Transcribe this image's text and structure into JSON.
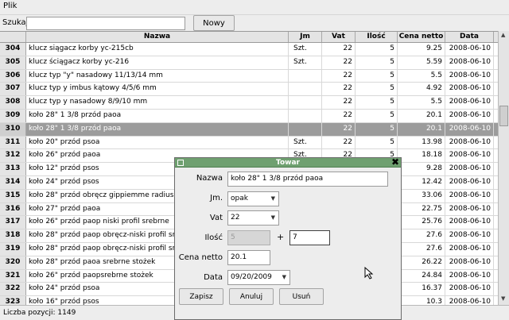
{
  "menubar": {
    "file_label": "Plik"
  },
  "search": {
    "label": "Szukaj",
    "value": "",
    "new_button": "Nowy"
  },
  "table": {
    "columns": [
      "",
      "Nazwa",
      "Jm",
      "Vat",
      "Ilość",
      "Cena netto",
      "Data"
    ],
    "rows": [
      {
        "id": "304",
        "name": "klucz siągacz korby yc-215cb",
        "jm": "Szt.",
        "vat": "22",
        "ilosc": "5",
        "cena": "9.25",
        "data": "2008-06-10"
      },
      {
        "id": "305",
        "name": "klucz ściągacz korby yc-216",
        "jm": "Szt.",
        "vat": "22",
        "ilosc": "5",
        "cena": "5.59",
        "data": "2008-06-10"
      },
      {
        "id": "306",
        "name": "klucz typ \"y\" nasadowy 11/13/14 mm",
        "jm": "",
        "vat": "22",
        "ilosc": "5",
        "cena": "5.5",
        "data": "2008-06-10"
      },
      {
        "id": "307",
        "name": "klucz typ y imbus kątowy  4/5/6 mm",
        "jm": "",
        "vat": "22",
        "ilosc": "5",
        "cena": "4.92",
        "data": "2008-06-10"
      },
      {
        "id": "308",
        "name": "klucz typ y nasadowy  8/9/10 mm",
        "jm": "",
        "vat": "22",
        "ilosc": "5",
        "cena": "5.5",
        "data": "2008-06-10"
      },
      {
        "id": "309",
        "name": "koło 28\" 1 3/8 przód  paoa",
        "jm": "",
        "vat": "22",
        "ilosc": "5",
        "cena": "20.1",
        "data": "2008-06-10"
      },
      {
        "id": "310",
        "name": "koło 28\" 1 3/8 przód paoa",
        "jm": "",
        "vat": "22",
        "ilosc": "5",
        "cena": "20.1",
        "data": "2008-06-10",
        "selected": true
      },
      {
        "id": "311",
        "name": "koło 20\"  przód psoa",
        "jm": "Szt.",
        "vat": "22",
        "ilosc": "5",
        "cena": "13.98",
        "data": "2008-06-10"
      },
      {
        "id": "312",
        "name": "koło 26\" przód  paoa",
        "jm": "Szt.",
        "vat": "22",
        "ilosc": "5",
        "cena": "18.18",
        "data": "2008-06-10"
      },
      {
        "id": "313",
        "name": "koło 12\" przód  psos",
        "jm": "",
        "vat": "",
        "ilosc": "",
        "cena": "9.28",
        "data": "2008-06-10"
      },
      {
        "id": "314",
        "name": "koło 24\" przód  psos",
        "jm": "",
        "vat": "",
        "ilosc": "",
        "cena": "12.42",
        "data": "2008-06-10"
      },
      {
        "id": "315",
        "name": "koło 28\" przód obręcz gippiemme radius",
        "jm": "",
        "vat": "",
        "ilosc": "",
        "cena": "33.06",
        "data": "2008-06-10"
      },
      {
        "id": "316",
        "name": "koło 27\" przód paoa",
        "jm": "",
        "vat": "",
        "ilosc": "",
        "cena": "22.75",
        "data": "2008-06-10"
      },
      {
        "id": "317",
        "name": "koło 26\" przód paop niski  profil srebrne",
        "jm": "",
        "vat": "",
        "ilosc": "",
        "cena": "25.76",
        "data": "2008-06-10"
      },
      {
        "id": "318",
        "name": "koło 28\" przód paop obręcz-niski profil srebrne",
        "jm": "",
        "vat": "",
        "ilosc": "",
        "cena": "27.6",
        "data": "2008-06-10"
      },
      {
        "id": "319",
        "name": "koło 28\" przód paop obręcz-niski profil srebrne",
        "jm": "",
        "vat": "",
        "ilosc": "",
        "cena": "27.6",
        "data": "2008-06-10"
      },
      {
        "id": "320",
        "name": "koło 28\" przód paoa srebrne stożek",
        "jm": "",
        "vat": "",
        "ilosc": "",
        "cena": "26.22",
        "data": "2008-06-10"
      },
      {
        "id": "321",
        "name": "koło 26\" przód paopsrebrne stożek",
        "jm": "",
        "vat": "",
        "ilosc": "",
        "cena": "24.84",
        "data": "2008-06-10"
      },
      {
        "id": "322",
        "name": "koło 24\" przód psoa",
        "jm": "",
        "vat": "",
        "ilosc": "",
        "cena": "16.37",
        "data": "2008-06-10"
      },
      {
        "id": "323",
        "name": "koło 16\" przód psos",
        "jm": "",
        "vat": "",
        "ilosc": "",
        "cena": "10.3",
        "data": "2008-06-10"
      }
    ]
  },
  "status": {
    "text": "Liczba pozycji: 1149"
  },
  "dialog": {
    "title": "Towar",
    "nazwa_label": "Nazwa",
    "nazwa_value": "koło 28\" 1 3/8 przód paoa",
    "jm_label": "Jm.",
    "jm_value": "opak",
    "vat_label": "Vat",
    "vat_value": "22",
    "ilosc_label": "Ilość",
    "ilosc_value": "5",
    "plus": "+",
    "ilosc_add_value": "7",
    "cena_label": "Cena netto",
    "cena_value": "20.1",
    "data_label": "Data",
    "data_value": "09/20/2009",
    "save_button": "Zapisz",
    "cancel_button": "Anuluj",
    "delete_button": "Usuń"
  },
  "colors": {
    "title_bar": "#6fa070",
    "selected_row": "#9c9c9c"
  }
}
